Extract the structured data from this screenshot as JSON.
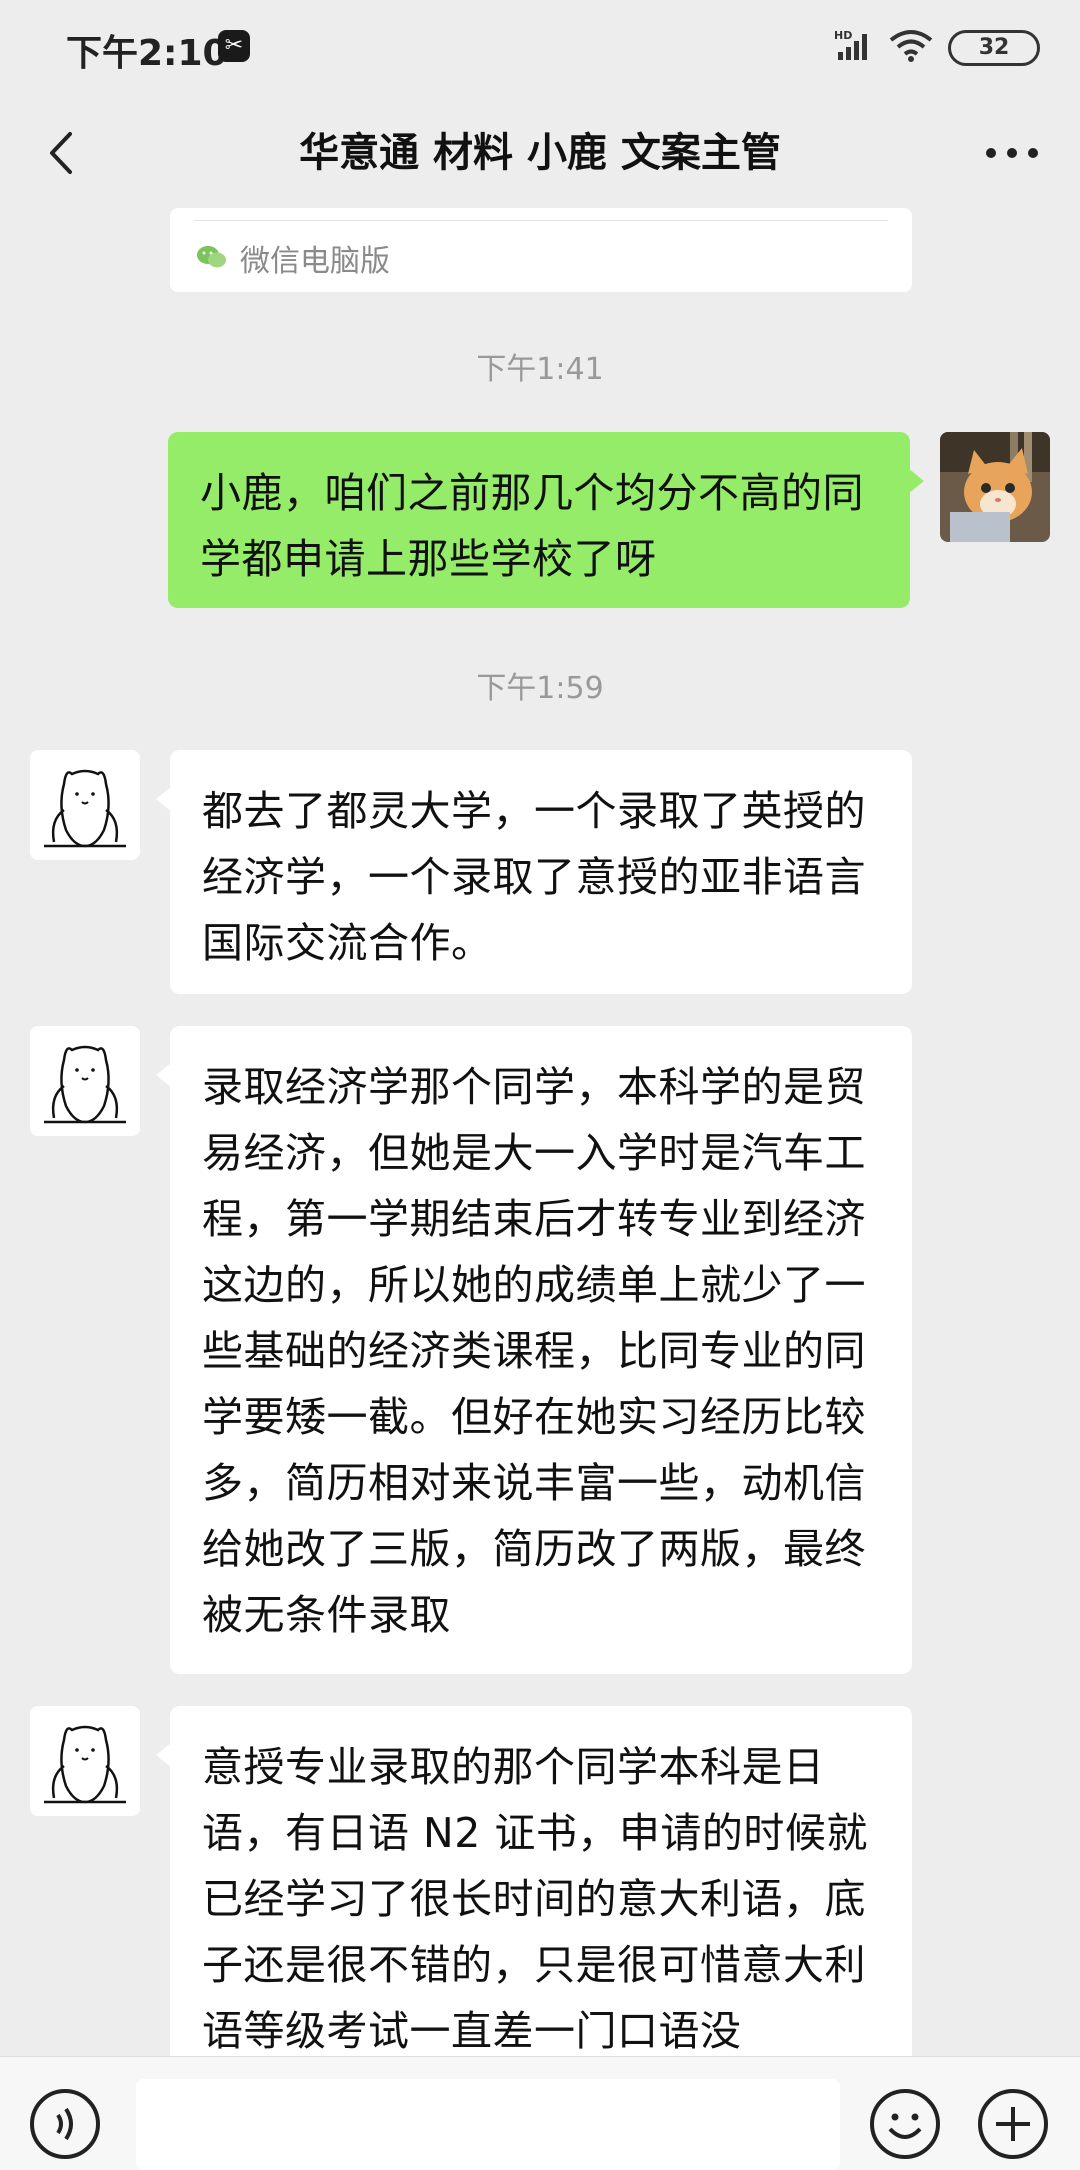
{
  "status_bar": {
    "time": "下午2:10",
    "battery": "32",
    "signal_label": "HD"
  },
  "nav": {
    "title": "华意通 材料 小鹿 文案主管"
  },
  "preview_card": {
    "source": "微信电脑版"
  },
  "messages": [
    {
      "type": "timestamp",
      "text": "下午1:41"
    },
    {
      "type": "sent",
      "text": "小鹿，咱们之前那几个均分不高的同学都申请上那些学校了呀"
    },
    {
      "type": "timestamp",
      "text": "下午1:59"
    },
    {
      "type": "received",
      "text": "都去了都灵大学，一个录取了英授的经济学，一个录取了意授的亚非语言国际交流合作。"
    },
    {
      "type": "received",
      "text": "录取经济学那个同学，本科学的是贸易经济，但她是大一入学时是汽车工程，第一学期结束后才转专业到经济这边的，所以她的成绩单上就少了一些基础的经济类课程，比同专业的同学要矮一截。但好在她实习经历比较多，简历相对来说丰富一些，动机信给她改了三版，简历改了两版，最终被无条件录取"
    },
    {
      "type": "received",
      "text": "意授专业录取的那个同学本科是日语，有日语 N2 证书，申请的时候就已经学习了很长时间的意大利语，底子还是很不错的，只是很可惜意大利语等级考试一直差一门口语没"
    }
  ],
  "colors": {
    "sent_bubble": "#95ec69",
    "received_bubble": "#ffffff",
    "background": "#ededed"
  }
}
